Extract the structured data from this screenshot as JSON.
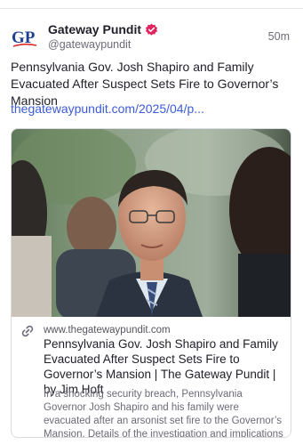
{
  "post": {
    "author_name": "Gateway Pundit",
    "avatar_text": "GP",
    "handle": "@gatewaypundit",
    "timestamp": "50m",
    "text": "Pennsylvania Gov. Josh Shapiro and Family Evacuated After Suspect Sets Fire to Governor’s Mansion",
    "link_text": "thegatewaypundit.com/2025/04/p..."
  },
  "card": {
    "domain": "www.thegatewaypundit.com",
    "title": "Pennsylvania Gov. Josh Shapiro and Family Evacuated After Suspect Sets Fire to Governor’s Mansion | The Gateway Pundit | by Jim Hoft",
    "description": "In a shocking security breach, Pennsylvania Governor Josh Shapiro and his family were evacuated after an arsonist set fire to the Governor’s Mansion. Details of the investigation and implications follow.",
    "image_icon": "news-photo-image"
  },
  "icons": {
    "verified": "verified-badge-icon",
    "link": "link-icon"
  },
  "colors": {
    "link": "#3b5bd9",
    "verified": "#e0245e",
    "avatar_blue": "#1f3f8f",
    "avatar_red": "#d92b2b"
  }
}
